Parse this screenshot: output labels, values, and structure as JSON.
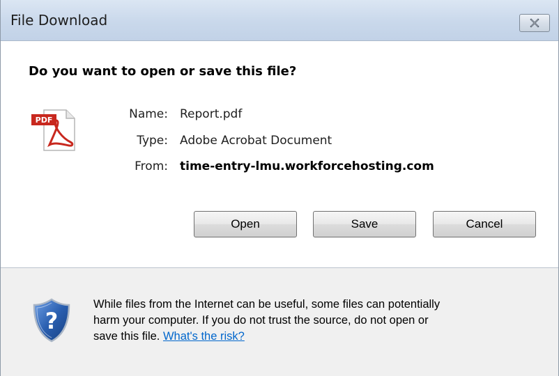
{
  "window": {
    "title": "File Download"
  },
  "dialog": {
    "question": "Do you want to open or save this file?",
    "file": {
      "name_label": "Name:",
      "name_value": "Report.pdf",
      "type_label": "Type:",
      "type_value": "Adobe Acrobat Document",
      "from_label": "From:",
      "from_value": "time-entry-lmu.workforcehosting.com",
      "icon_badge": "PDF"
    },
    "buttons": {
      "open": "Open",
      "save": "Save",
      "cancel": "Cancel"
    }
  },
  "footer": {
    "warning_line1": "While files from the Internet can be useful, some files can potentially",
    "warning_line2": "harm your computer. If you do not trust the source, do not open or",
    "warning_line3": "save this file.",
    "risk_link": "What's the risk?"
  },
  "colors": {
    "link": "#0066cc",
    "pdf_red": "#c8281e",
    "shield_blue": "#2a5fb0"
  }
}
